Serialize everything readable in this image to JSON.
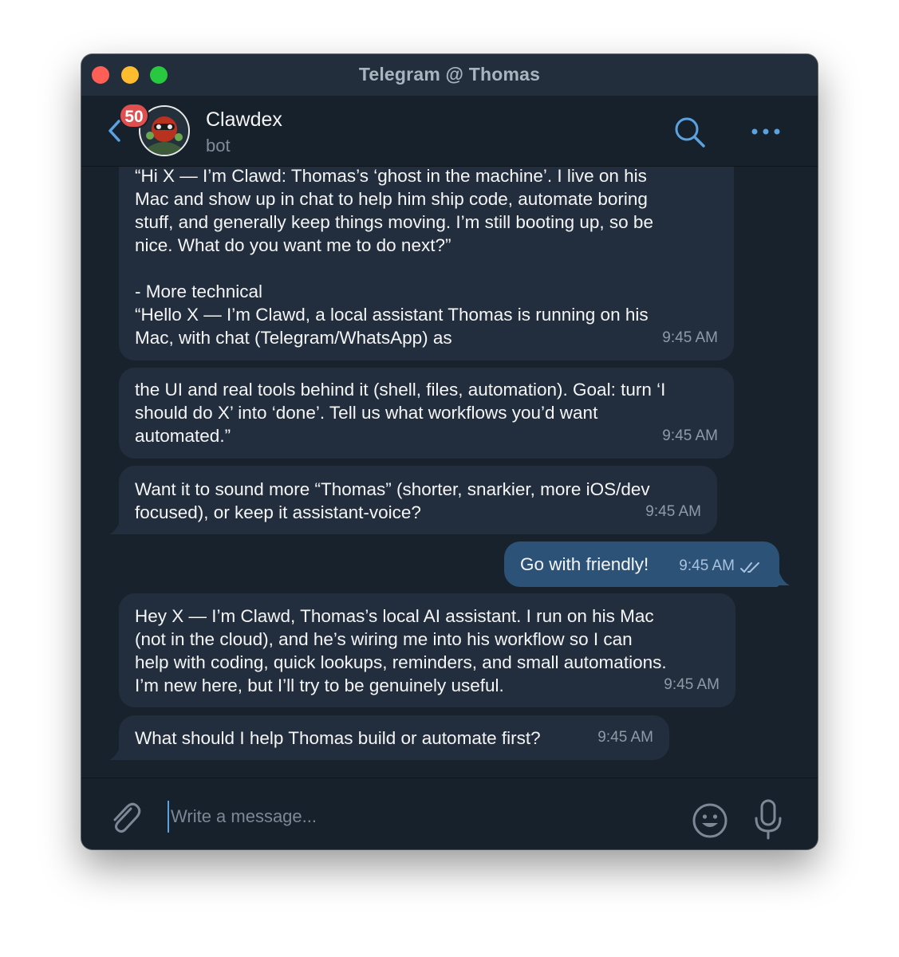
{
  "window": {
    "title": "Telegram @ Thomas"
  },
  "header": {
    "back_icon": "chevron-left-icon",
    "unread_badge": "50",
    "chat_name": "Clawdex",
    "chat_status": "bot",
    "search_icon": "search-icon",
    "more_icon": "more-horizontal-icon"
  },
  "messages": [
    {
      "direction": "incoming",
      "text": "“Hi X — I’m Clawd: Thomas’s ‘ghost in the machine’. I live on his\nMac and show up in chat to help him ship code, automate boring\nstuff, and generally keep things moving. I’m still booting up, so be\nnice. What do you want me to do next?”\n\n- More technical\n“Hello X — I’m Clawd, a local assistant Thomas is running on his\nMac, with chat (Telegram/WhatsApp) as",
      "time": "9:45 AM"
    },
    {
      "direction": "incoming",
      "text": "the UI and real tools behind it (shell, files, automation). Goal: turn ‘I\nshould do X’ into ‘done’. Tell us what workflows you’d want\nautomated.”",
      "time": "9:45 AM"
    },
    {
      "direction": "incoming",
      "text": "Want it to sound more “Thomas” (shorter, snarkier, more iOS/dev\nfocused), or keep it assistant-voice?",
      "time": "9:45 AM"
    },
    {
      "direction": "outgoing",
      "text": "Go with friendly!",
      "time": "9:45 AM",
      "status_icon": "double-check-icon"
    },
    {
      "direction": "incoming",
      "text": "Hey X — I’m Clawd, Thomas’s local AI assistant. I run on his Mac\n(not in the cloud), and he’s wiring me into his workflow so I can\nhelp with coding, quick lookups, reminders, and small automations.\nI’m new here, but I’ll try to be genuinely useful.",
      "time": "9:45 AM"
    },
    {
      "direction": "incoming",
      "text": "What should I help Thomas build or automate first?",
      "time": "9:45 AM"
    }
  ],
  "composer": {
    "placeholder": "Write a message...",
    "attach_icon": "paperclip-icon",
    "emoji_icon": "emoji-icon",
    "mic_icon": "microphone-icon"
  },
  "colors": {
    "window_bg": "#18222d",
    "bubble_incoming": "#222e3d",
    "bubble_outgoing": "#2c5278",
    "accent": "#5aa2e0",
    "badge": "#e04f4f"
  }
}
